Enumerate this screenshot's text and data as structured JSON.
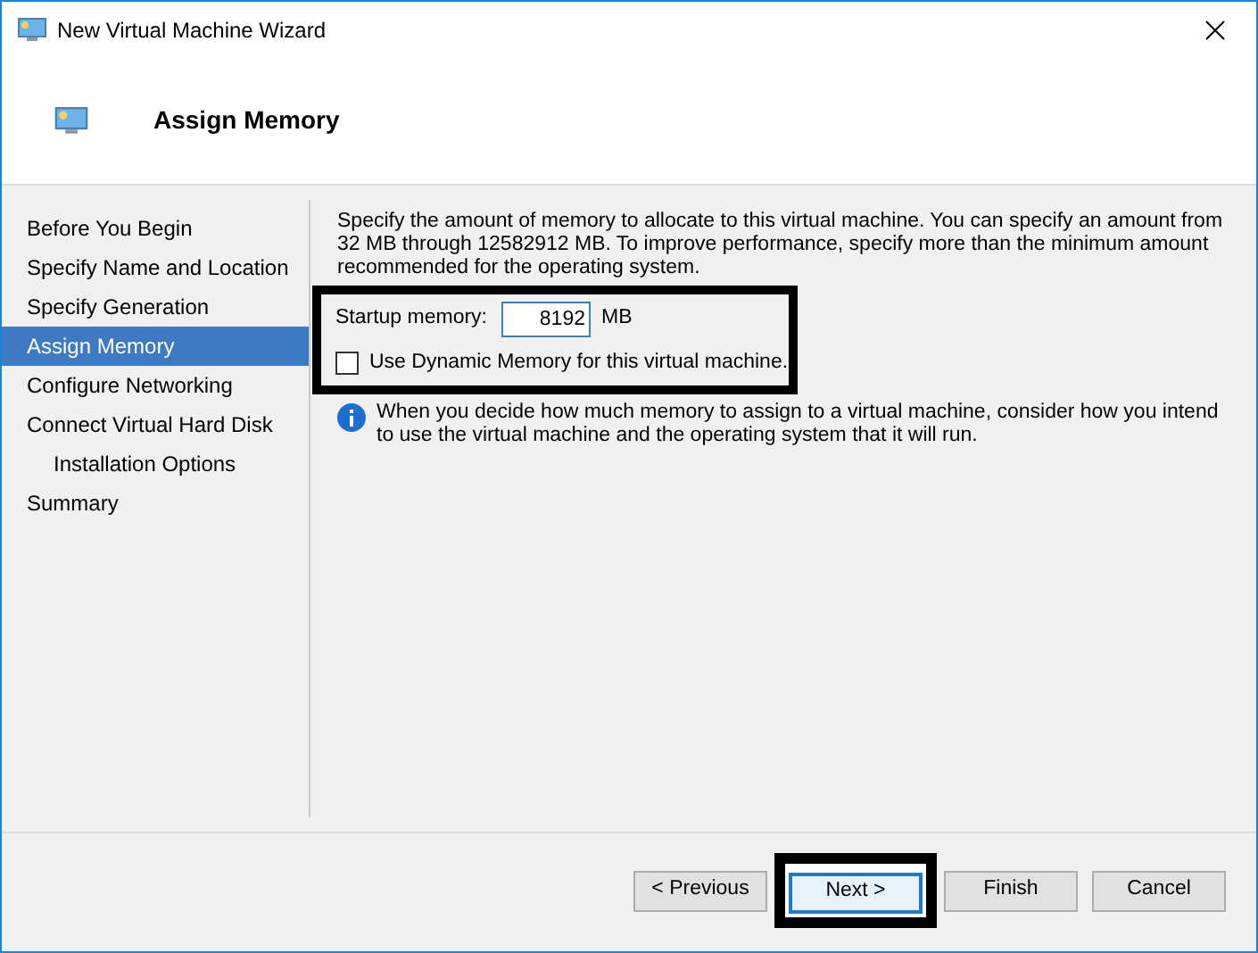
{
  "window": {
    "title": "New Virtual Machine Wizard"
  },
  "header": {
    "title": "Assign Memory"
  },
  "sidebar": {
    "items": [
      {
        "label": "Before You Begin",
        "selected": false
      },
      {
        "label": "Specify Name and Location",
        "selected": false
      },
      {
        "label": "Specify Generation",
        "selected": false
      },
      {
        "label": "Assign Memory",
        "selected": true
      },
      {
        "label": "Configure Networking",
        "selected": false
      },
      {
        "label": "Connect Virtual Hard Disk",
        "selected": false,
        "children": [
          {
            "label": "Installation Options",
            "selected": false
          }
        ]
      },
      {
        "label": "Summary",
        "selected": false
      }
    ]
  },
  "description": "Specify the amount of memory to allocate to this virtual machine. You can specify an amount from 32 MB through 12582912 MB. To improve performance, specify more than the minimum amount recommended for the operating system.",
  "startup_memory": {
    "label": "Startup memory:",
    "value": "8192",
    "unit": "MB"
  },
  "dynamic_memory": {
    "label": "Use Dynamic Memory for this virtual machine.",
    "checked": false
  },
  "info": "When you decide how much memory to assign to a virtual machine, consider how you intend to use the virtual machine and the operating system that it will run.",
  "buttons": [
    {
      "label": "< Previous",
      "focused": false
    },
    {
      "label": "Next >",
      "focused": true
    },
    {
      "label": "Finish",
      "focused": false
    },
    {
      "label": "Cancel",
      "focused": false
    }
  ]
}
